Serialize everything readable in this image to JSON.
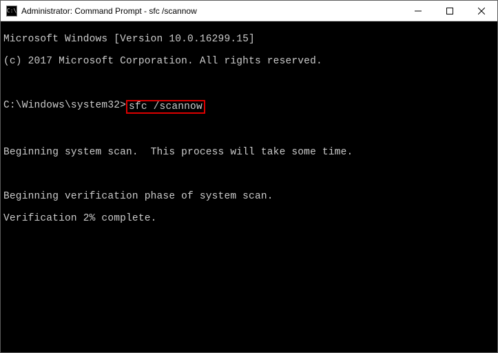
{
  "titlebar": {
    "icon_glyph": "C:\\",
    "title": "Administrator: Command Prompt - sfc  /scannow"
  },
  "console": {
    "line1": "Microsoft Windows [Version 10.0.16299.15]",
    "line2": "(c) 2017 Microsoft Corporation. All rights reserved.",
    "blank1": " ",
    "prompt": "C:\\Windows\\system32>",
    "command": "sfc /scannow",
    "blank2": " ",
    "line3": "Beginning system scan.  This process will take some time.",
    "blank3": " ",
    "line4": "Beginning verification phase of system scan.",
    "line5": "Verification 2% complete."
  }
}
